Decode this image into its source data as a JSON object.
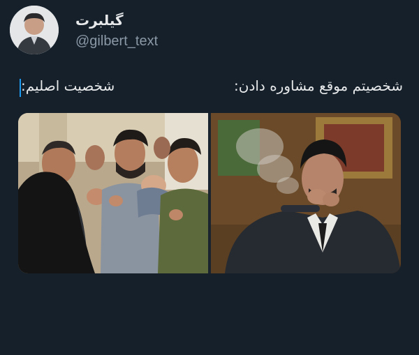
{
  "author": {
    "display_name": "گیلبرت",
    "handle": "@gilbert_text"
  },
  "tweet": {
    "caption_right": "شخصیتم موقع مشاوره دادن:",
    "caption_left": "شخصیت اصلیم:"
  },
  "colors": {
    "background": "#15202b",
    "text": "#e7e9ea",
    "muted": "#8b98a5",
    "accent": "#1d9bf0"
  }
}
